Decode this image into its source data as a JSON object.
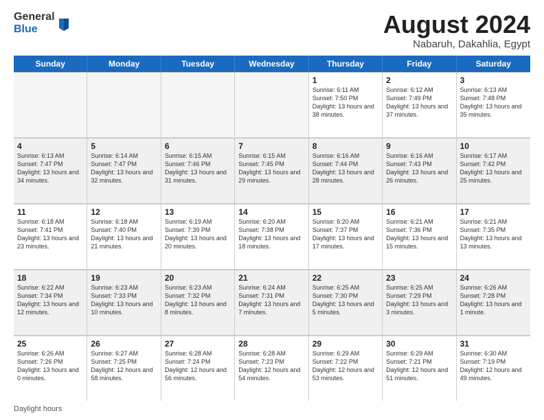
{
  "logo": {
    "general": "General",
    "blue": "Blue"
  },
  "header": {
    "title": "August 2024",
    "subtitle": "Nabaruh, Dakahlia, Egypt"
  },
  "days_of_week": [
    "Sunday",
    "Monday",
    "Tuesday",
    "Wednesday",
    "Thursday",
    "Friday",
    "Saturday"
  ],
  "footer": {
    "label": "Daylight hours"
  },
  "weeks": [
    [
      {
        "day": "",
        "info": "",
        "empty": true
      },
      {
        "day": "",
        "info": "",
        "empty": true
      },
      {
        "day": "",
        "info": "",
        "empty": true
      },
      {
        "day": "",
        "info": "",
        "empty": true
      },
      {
        "day": "1",
        "info": "Sunrise: 6:11 AM\nSunset: 7:50 PM\nDaylight: 13 hours\nand 38 minutes."
      },
      {
        "day": "2",
        "info": "Sunrise: 6:12 AM\nSunset: 7:49 PM\nDaylight: 13 hours\nand 37 minutes."
      },
      {
        "day": "3",
        "info": "Sunrise: 6:13 AM\nSunset: 7:48 PM\nDaylight: 13 hours\nand 35 minutes."
      }
    ],
    [
      {
        "day": "4",
        "info": "Sunrise: 6:13 AM\nSunset: 7:47 PM\nDaylight: 13 hours\nand 34 minutes."
      },
      {
        "day": "5",
        "info": "Sunrise: 6:14 AM\nSunset: 7:47 PM\nDaylight: 13 hours\nand 32 minutes."
      },
      {
        "day": "6",
        "info": "Sunrise: 6:15 AM\nSunset: 7:46 PM\nDaylight: 13 hours\nand 31 minutes."
      },
      {
        "day": "7",
        "info": "Sunrise: 6:15 AM\nSunset: 7:45 PM\nDaylight: 13 hours\nand 29 minutes."
      },
      {
        "day": "8",
        "info": "Sunrise: 6:16 AM\nSunset: 7:44 PM\nDaylight: 13 hours\nand 28 minutes."
      },
      {
        "day": "9",
        "info": "Sunrise: 6:16 AM\nSunset: 7:43 PM\nDaylight: 13 hours\nand 26 minutes."
      },
      {
        "day": "10",
        "info": "Sunrise: 6:17 AM\nSunset: 7:42 PM\nDaylight: 13 hours\nand 25 minutes."
      }
    ],
    [
      {
        "day": "11",
        "info": "Sunrise: 6:18 AM\nSunset: 7:41 PM\nDaylight: 13 hours\nand 23 minutes."
      },
      {
        "day": "12",
        "info": "Sunrise: 6:18 AM\nSunset: 7:40 PM\nDaylight: 13 hours\nand 21 minutes."
      },
      {
        "day": "13",
        "info": "Sunrise: 6:19 AM\nSunset: 7:39 PM\nDaylight: 13 hours\nand 20 minutes."
      },
      {
        "day": "14",
        "info": "Sunrise: 6:20 AM\nSunset: 7:38 PM\nDaylight: 13 hours\nand 18 minutes."
      },
      {
        "day": "15",
        "info": "Sunrise: 6:20 AM\nSunset: 7:37 PM\nDaylight: 13 hours\nand 17 minutes."
      },
      {
        "day": "16",
        "info": "Sunrise: 6:21 AM\nSunset: 7:36 PM\nDaylight: 13 hours\nand 15 minutes."
      },
      {
        "day": "17",
        "info": "Sunrise: 6:21 AM\nSunset: 7:35 PM\nDaylight: 13 hours\nand 13 minutes."
      }
    ],
    [
      {
        "day": "18",
        "info": "Sunrise: 6:22 AM\nSunset: 7:34 PM\nDaylight: 13 hours\nand 12 minutes."
      },
      {
        "day": "19",
        "info": "Sunrise: 6:23 AM\nSunset: 7:33 PM\nDaylight: 13 hours\nand 10 minutes."
      },
      {
        "day": "20",
        "info": "Sunrise: 6:23 AM\nSunset: 7:32 PM\nDaylight: 13 hours\nand 8 minutes."
      },
      {
        "day": "21",
        "info": "Sunrise: 6:24 AM\nSunset: 7:31 PM\nDaylight: 13 hours\nand 7 minutes."
      },
      {
        "day": "22",
        "info": "Sunrise: 6:25 AM\nSunset: 7:30 PM\nDaylight: 13 hours\nand 5 minutes."
      },
      {
        "day": "23",
        "info": "Sunrise: 6:25 AM\nSunset: 7:29 PM\nDaylight: 13 hours\nand 3 minutes."
      },
      {
        "day": "24",
        "info": "Sunrise: 6:26 AM\nSunset: 7:28 PM\nDaylight: 13 hours\nand 1 minute."
      }
    ],
    [
      {
        "day": "25",
        "info": "Sunrise: 6:26 AM\nSunset: 7:26 PM\nDaylight: 13 hours\nand 0 minutes."
      },
      {
        "day": "26",
        "info": "Sunrise: 6:27 AM\nSunset: 7:25 PM\nDaylight: 12 hours\nand 58 minutes."
      },
      {
        "day": "27",
        "info": "Sunrise: 6:28 AM\nSunset: 7:24 PM\nDaylight: 12 hours\nand 56 minutes."
      },
      {
        "day": "28",
        "info": "Sunrise: 6:28 AM\nSunset: 7:23 PM\nDaylight: 12 hours\nand 54 minutes."
      },
      {
        "day": "29",
        "info": "Sunrise: 6:29 AM\nSunset: 7:22 PM\nDaylight: 12 hours\nand 53 minutes."
      },
      {
        "day": "30",
        "info": "Sunrise: 6:29 AM\nSunset: 7:21 PM\nDaylight: 12 hours\nand 51 minutes."
      },
      {
        "day": "31",
        "info": "Sunrise: 6:30 AM\nSunset: 7:19 PM\nDaylight: 12 hours\nand 49 minutes."
      }
    ]
  ]
}
